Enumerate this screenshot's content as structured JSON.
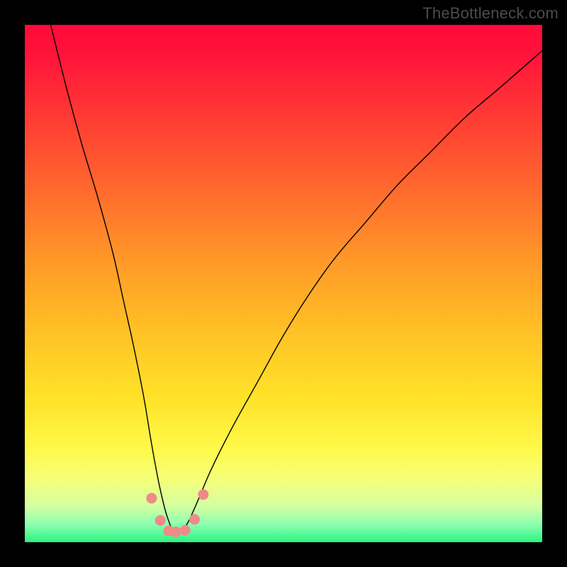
{
  "watermark": "TheBottleneck.com",
  "chart_data": {
    "type": "line",
    "title": "",
    "xlabel": "",
    "ylabel": "",
    "xlim": [
      0,
      100
    ],
    "ylim": [
      0,
      100
    ],
    "background_gradient": {
      "stops": [
        {
          "offset": 0.0,
          "color": "#ff0a3a"
        },
        {
          "offset": 0.06,
          "color": "#ff143a"
        },
        {
          "offset": 0.18,
          "color": "#ff3b34"
        },
        {
          "offset": 0.32,
          "color": "#ff6a2d"
        },
        {
          "offset": 0.46,
          "color": "#ff9a28"
        },
        {
          "offset": 0.6,
          "color": "#ffc326"
        },
        {
          "offset": 0.72,
          "color": "#ffe228"
        },
        {
          "offset": 0.82,
          "color": "#fff94a"
        },
        {
          "offset": 0.88,
          "color": "#f5ff7a"
        },
        {
          "offset": 0.93,
          "color": "#d3ffa0"
        },
        {
          "offset": 0.965,
          "color": "#8dffb0"
        },
        {
          "offset": 1.0,
          "color": "#29f57f"
        }
      ]
    },
    "series": [
      {
        "name": "bottleneck-curve",
        "color": "#000000",
        "stroke_width": 1.4,
        "x": [
          5,
          8,
          11,
          14,
          17,
          19,
          21,
          23,
          24.5,
          26,
          27.5,
          29,
          31,
          33,
          36,
          40,
          45,
          50,
          55,
          60,
          66,
          72,
          78,
          85,
          92,
          100
        ],
        "values": [
          100,
          88,
          77,
          67,
          56,
          47,
          38,
          28,
          19,
          11,
          5,
          2,
          3,
          7,
          14,
          22,
          31,
          40,
          48,
          55,
          62,
          69,
          75,
          82,
          88,
          95
        ]
      }
    ],
    "markers": {
      "name": "highlight-points",
      "color": "#ef8a88",
      "radius": 7.5,
      "x": [
        24.5,
        26.2,
        27.8,
        29.2,
        31.0,
        32.8,
        34.5
      ],
      "values": [
        8.5,
        4.2,
        2.2,
        2.0,
        2.3,
        4.4,
        9.2
      ]
    }
  }
}
